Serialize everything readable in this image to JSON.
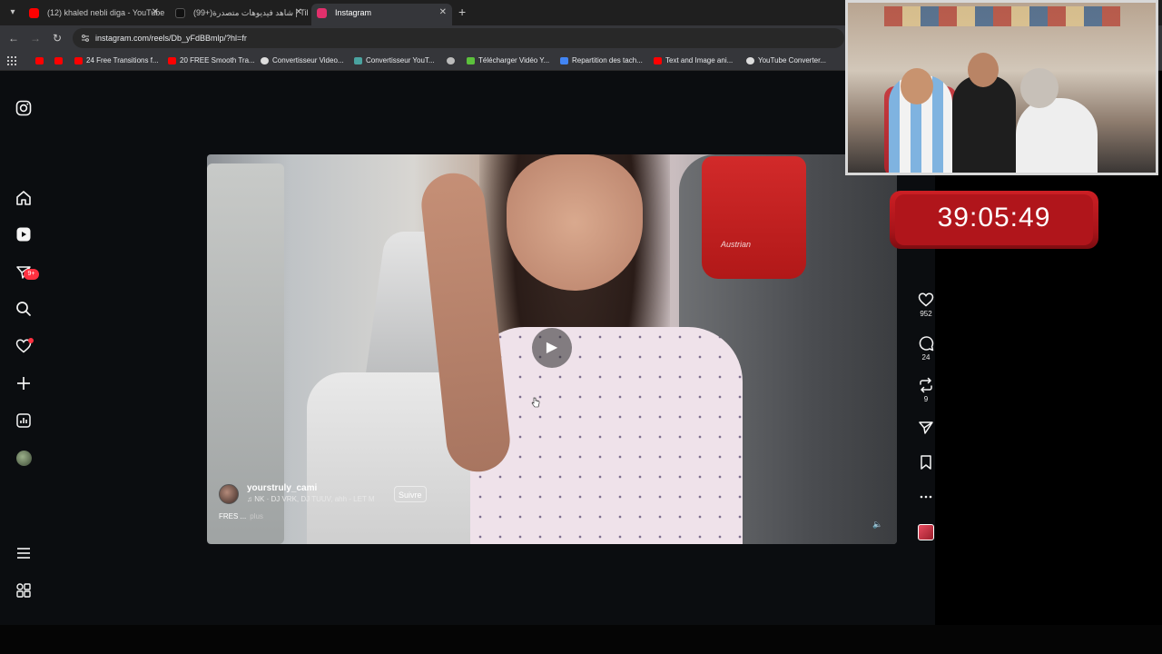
{
  "browser": {
    "tabs": [
      {
        "title": "(12) khaled nebli diga - YouTube",
        "color": "#ff0000",
        "active": false
      },
      {
        "title": "(99+)شاهد فيديوهات متصدرة | TikTok",
        "color": "#111111",
        "active": false
      },
      {
        "title": "Instagram",
        "color": "#e1306c",
        "active": true
      }
    ],
    "new_tab_glyph": "+",
    "address": "instagram.com/reels/Db_yFdBBmlp/?hl=fr",
    "bookmarks": [
      {
        "label": "",
        "color": "#ff0000"
      },
      {
        "label": "",
        "color": "#ff0000"
      },
      {
        "label": "24 Free Transitions f...",
        "color": "#ff0000"
      },
      {
        "label": "20 FREE Smooth Tra...",
        "color": "#ff0000"
      },
      {
        "label": "Convertisseur Video...",
        "color": "#dddddd"
      },
      {
        "label": "Convertisseur YouT...",
        "color": "#4aa3a0"
      },
      {
        "label": "",
        "color": "#bbbbbb"
      },
      {
        "label": "Télécharger Vidéo Y...",
        "color": "#5cc13c"
      },
      {
        "label": "Repartition des tach...",
        "color": "#4285f4"
      },
      {
        "label": "Text and Image ani...",
        "color": "#ff0000"
      },
      {
        "label": "YouTube Converter...",
        "color": "#dddddd"
      }
    ]
  },
  "sidebar": {
    "messages_badge": "9+"
  },
  "reel": {
    "author": "yourstruly_cami",
    "music": "NK · DJ VRK, DJ TUUV, ahh - LET M",
    "follow_label": "Suivre",
    "caption": "FRES ...",
    "more_label": "plus",
    "seat_brand": "Austrian",
    "likes": "952",
    "comments": "24",
    "reposts": "9"
  },
  "stream": {
    "timer": "39:05:49"
  },
  "colors": {
    "accent_red": "#ff3040",
    "timer_red": "#b0151b"
  }
}
